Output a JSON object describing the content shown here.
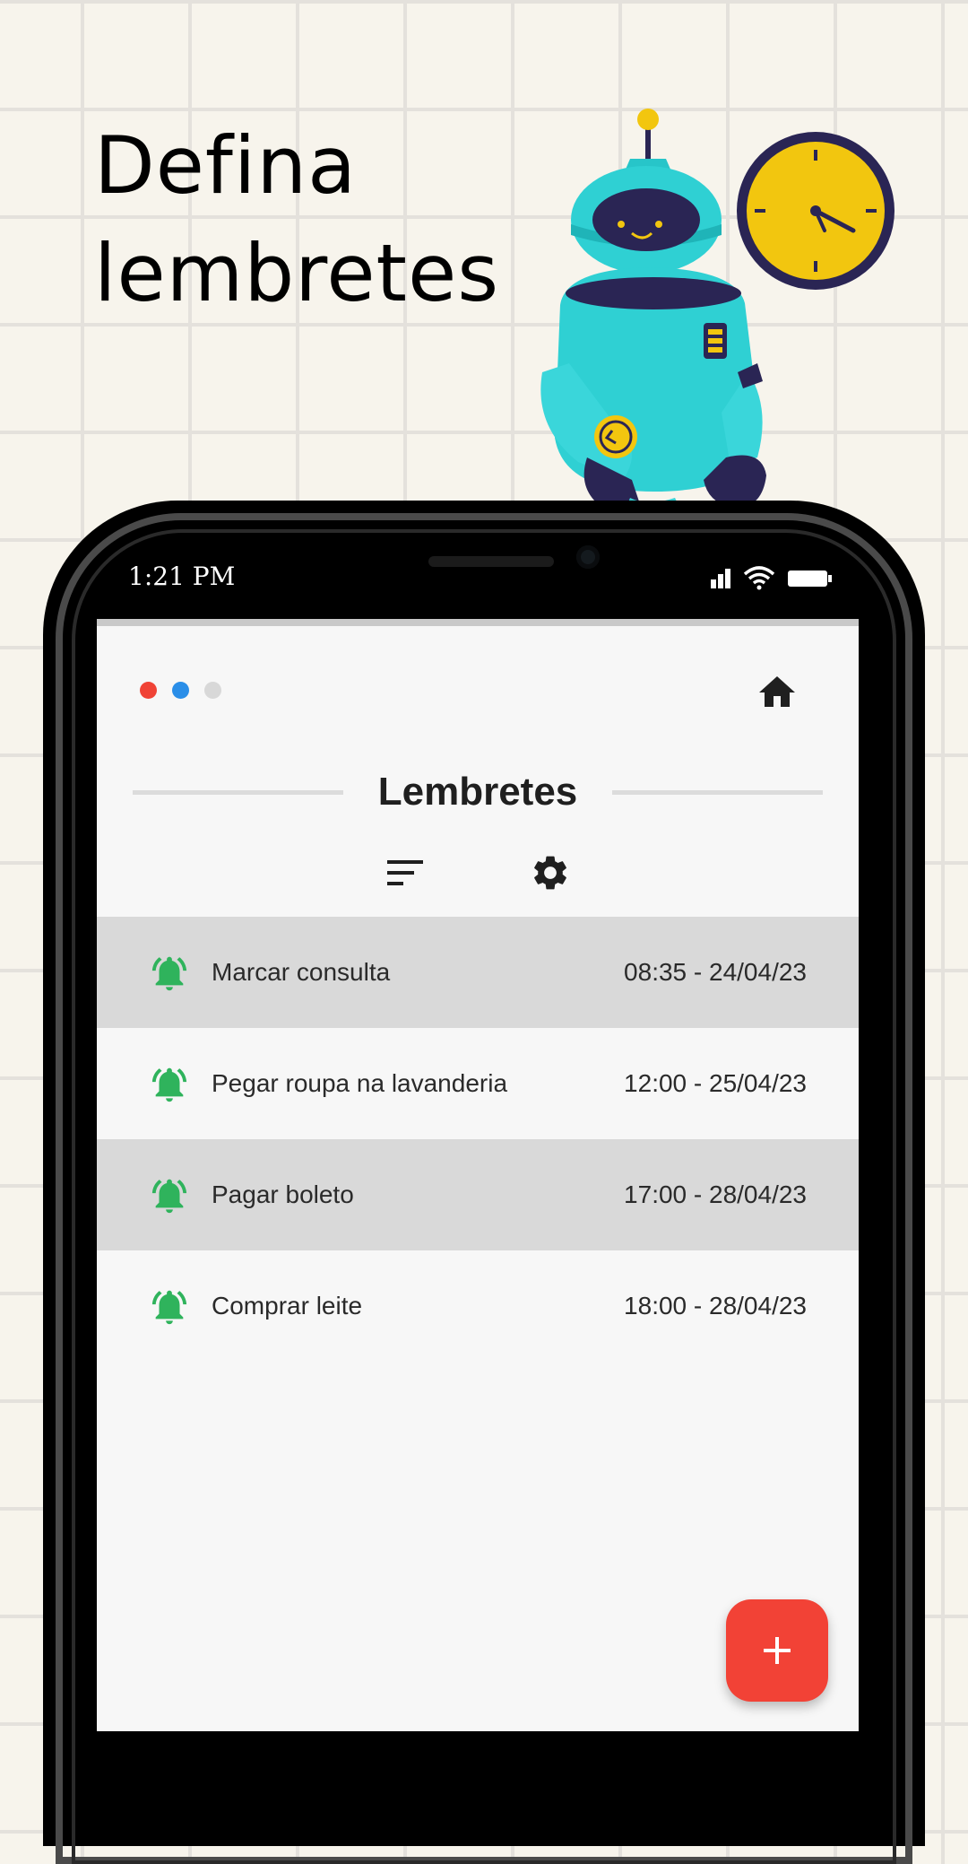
{
  "promo": {
    "headline_line1": "Defina",
    "headline_line2": "lembretes"
  },
  "status_bar": {
    "time": "1:21 PM",
    "icons": [
      "signal-icon",
      "wifi-icon",
      "battery-icon"
    ]
  },
  "app": {
    "page_dots": [
      {
        "color": "#f04336",
        "state": "active"
      },
      {
        "color": "#2a8ee8",
        "state": "active"
      },
      {
        "color": "#d8d8d8",
        "state": "inactive"
      }
    ],
    "title": "Lembretes",
    "toolbar_icons": [
      "sort-icon",
      "gear-icon"
    ],
    "header_icon": "home-icon",
    "fab_icon": "plus-icon"
  },
  "reminders": [
    {
      "title": "Marcar consulta",
      "datetime": "08:35 - 24/04/23",
      "shaded": true
    },
    {
      "title": "Pegar roupa na lavanderia",
      "datetime": "12:00 - 25/04/23",
      "shaded": false
    },
    {
      "title": "Pagar boleto",
      "datetime": "17:00 - 28/04/23",
      "shaded": true
    },
    {
      "title": "Comprar leite",
      "datetime": "18:00 - 28/04/23",
      "shaded": false
    }
  ],
  "colors": {
    "accent_green": "#2fb35c",
    "fab_red": "#f24236",
    "shaded_row": "#d9d9d9"
  }
}
